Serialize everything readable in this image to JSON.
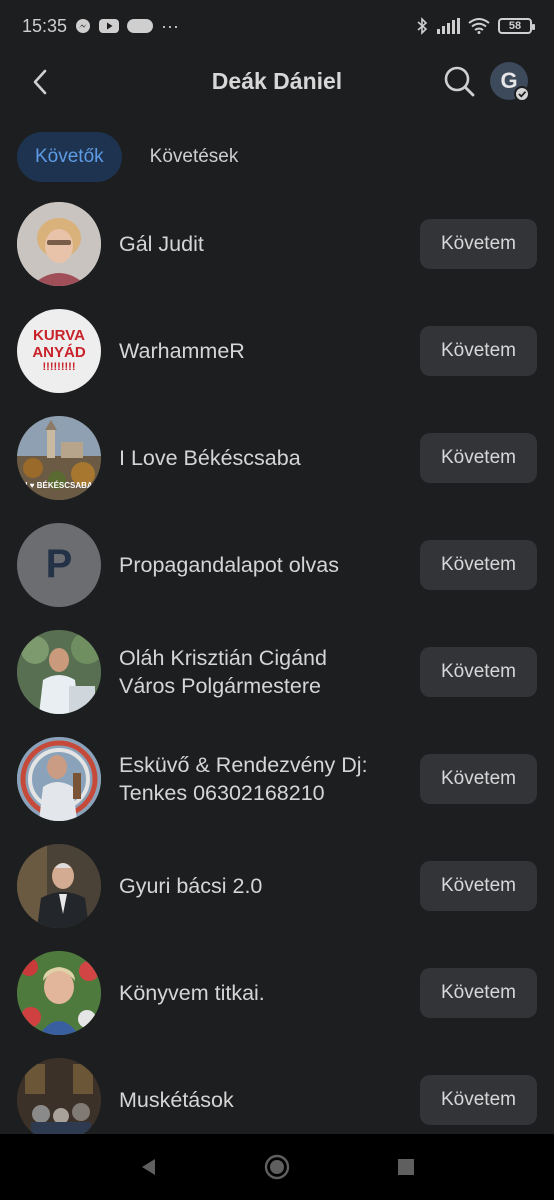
{
  "status_bar": {
    "time": "15:35",
    "dots": "···",
    "battery": "58"
  },
  "header": {
    "title": "Deák Dániel"
  },
  "tabs": [
    {
      "label": "Követők",
      "active": true
    },
    {
      "label": "Követések",
      "active": false
    }
  ],
  "follow_label": "Követem",
  "items": [
    {
      "name": "Gál Judit",
      "avatar": "photo-woman"
    },
    {
      "name": "WarhammeR",
      "avatar": "text-logo",
      "avatar_text": [
        "KURVA",
        "ANYÁD",
        "!!!!!!!!!"
      ]
    },
    {
      "name": "I Love Békéscsaba",
      "avatar": "city-photo",
      "avatar_text": [
        "I ♥ BÉKÉSCSABA"
      ]
    },
    {
      "name": "Propagandalapot olvas",
      "avatar": "letter",
      "avatar_text": [
        "P"
      ]
    },
    {
      "name": "Oláh Krisztián Cigánd\nVáros Polgármestere",
      "avatar": "photo-speaker"
    },
    {
      "name": "Esküvő & Rendezvény Dj:\nTenkes  06302168210",
      "avatar": "photo-dj"
    },
    {
      "name": "Gyuri bácsi 2.0",
      "avatar": "photo-man"
    },
    {
      "name": "Könyvem titkai.",
      "avatar": "photo-flowers"
    },
    {
      "name": "Muskétások",
      "avatar": "photo-group"
    }
  ],
  "colors": {
    "background": "#1d1e20",
    "active_tab_bg": "#1d3350",
    "active_tab_text": "#5e9be4",
    "button_bg": "#323438"
  }
}
